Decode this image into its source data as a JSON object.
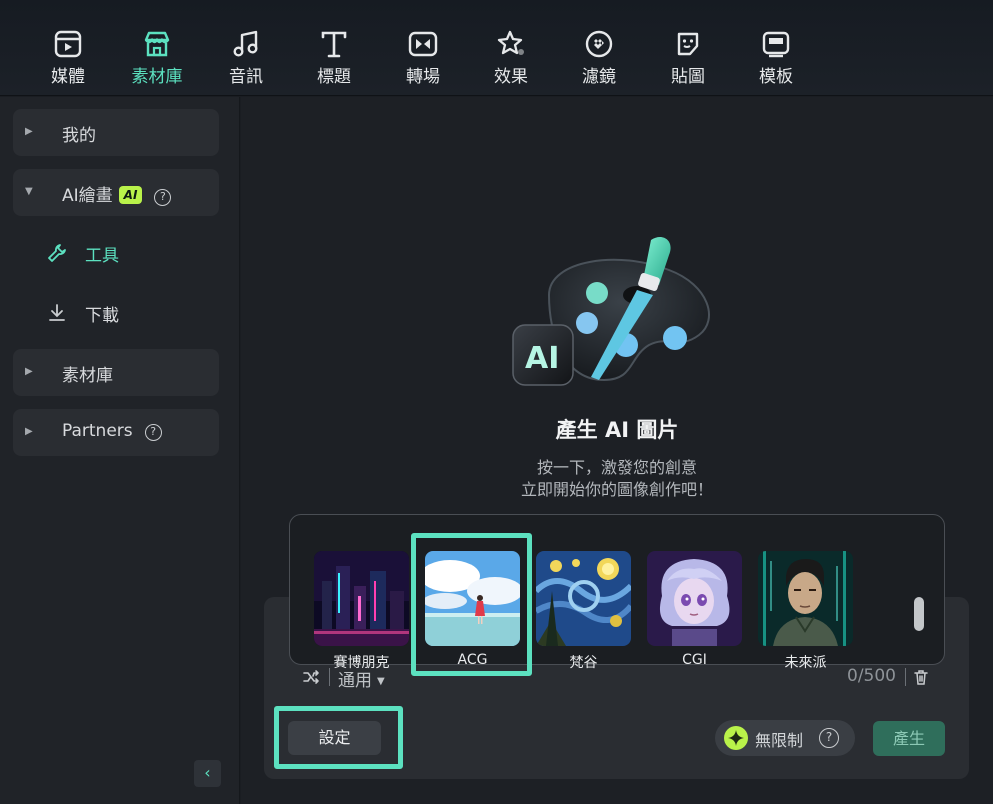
{
  "toolbar": {
    "tabs": [
      {
        "label": "媒體",
        "icon": "media-icon"
      },
      {
        "label": "素材庫",
        "icon": "store-icon",
        "active": true
      },
      {
        "label": "音訊",
        "icon": "music-icon"
      },
      {
        "label": "標題",
        "icon": "title-icon"
      },
      {
        "label": "轉場",
        "icon": "transition-icon"
      },
      {
        "label": "效果",
        "icon": "effects-icon"
      },
      {
        "label": "濾鏡",
        "icon": "filter-icon"
      },
      {
        "label": "貼圖",
        "icon": "sticker-icon"
      },
      {
        "label": "模板",
        "icon": "template-icon"
      }
    ],
    "accent_color": "#5ce1c0"
  },
  "sidebar": {
    "mine": "我的",
    "ai_paint": "AI繪畫",
    "ai_badge": "AI",
    "tools": "工具",
    "download": "下載",
    "library": "素材庫",
    "partners": "Partners"
  },
  "main": {
    "hero_title": "產生 AI 圖片",
    "hero_line1": "按一下，激發您的創意",
    "hero_line2": "立即開始你的圖像創作吧！",
    "styles": [
      {
        "name": "賽博朋克"
      },
      {
        "name": "ACG",
        "selected": true
      },
      {
        "name": "梵谷"
      },
      {
        "name": "CGI"
      },
      {
        "name": "未來派"
      }
    ],
    "mode": "通用",
    "char_count": "0/500",
    "settings": "設定",
    "unlimited": "無限制",
    "generate": "產生"
  }
}
